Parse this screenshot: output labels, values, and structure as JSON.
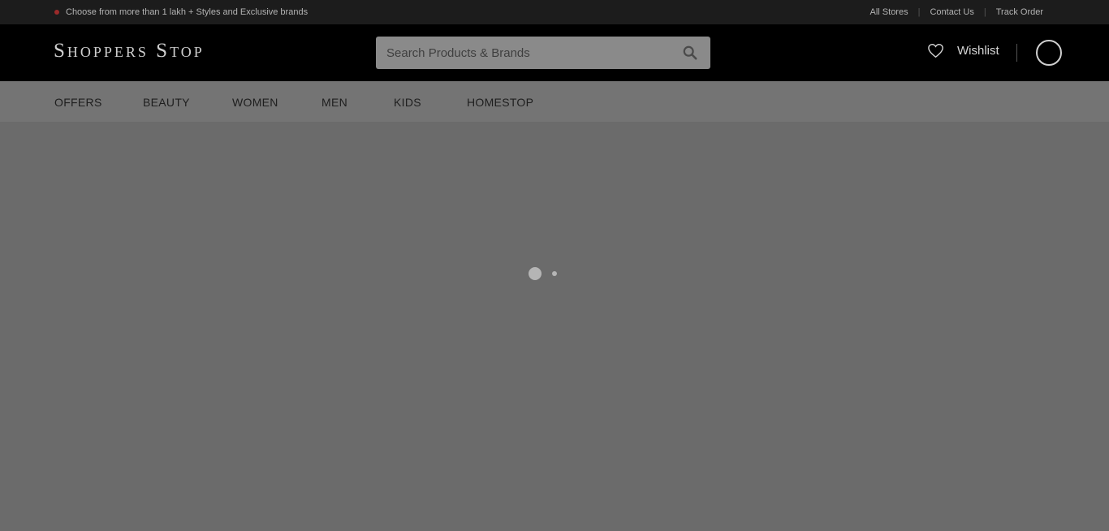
{
  "topbar": {
    "promo_text": "Choose from more than 1 lakh + Styles and Exclusive brands",
    "links": [
      "All Stores",
      "Contact Us",
      "Track Order"
    ]
  },
  "header": {
    "logo": "Shoppers Stop",
    "search_placeholder": "Search Products & Brands",
    "wishlist_label": "Wishlist"
  },
  "nav": {
    "items": [
      "OFFERS",
      "BEAUTY",
      "WOMEN",
      "MEN",
      "KIDS",
      "HOMESTOP"
    ]
  },
  "icons": {
    "search": "search-icon",
    "wishlist": "heart-icon",
    "account": "user-avatar-icon"
  },
  "colors": {
    "topbar_bg": "#1c1c1c",
    "header_bg": "#000000",
    "promo_dot": "#9b2a2a"
  }
}
